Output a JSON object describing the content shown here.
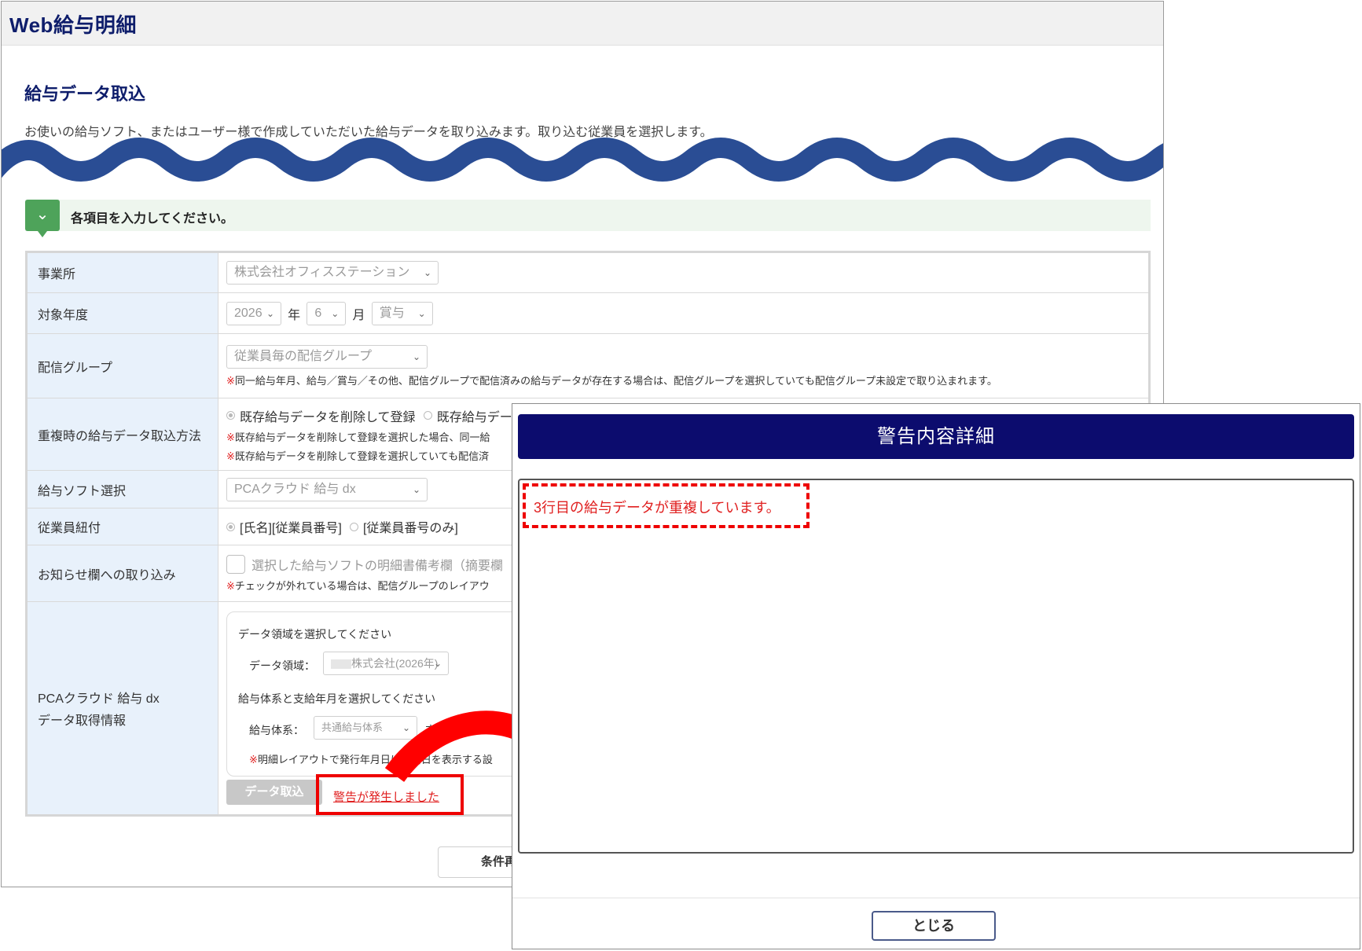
{
  "app": {
    "title": "Web給与明細"
  },
  "page": {
    "title": "給与データ取込",
    "description": "お使いの給与ソフト、またはユーザー様で作成していただいた給与データを取り込みます。取り込む従業員を選択します。"
  },
  "notice": {
    "text": "各項目を入力してください。"
  },
  "form": {
    "office": {
      "label": "事業所",
      "value": "株式会社オフィスステーション"
    },
    "target_year": {
      "label": "対象年度",
      "year": "2026",
      "year_unit": "年",
      "month": "6",
      "month_unit": "月",
      "type": "賞与"
    },
    "group": {
      "label": "配信グループ",
      "value": "従業員毎の配信グループ",
      "note_mark": "※",
      "note": "同一給与年月、給与／賞与／その他、配信グループで配信済みの給与データが存在する場合は、配信グループを選択していても配信グループ未設定で取り込まれます。"
    },
    "duplicate": {
      "label": "重複時の給与データ取込方法",
      "option1": "既存給与データを削除して登録",
      "option2": "既存給与デー",
      "note1_mark": "※",
      "note1": "既存給与データを削除して登録を選択した場合、同一給",
      "note2_mark": "※",
      "note2": "既存給与データを削除して登録を選択していても配信済"
    },
    "software": {
      "label": "給与ソフト選択",
      "value": "PCAクラウド 給与 dx"
    },
    "employee_link": {
      "label": "従業員紐付",
      "option1": "[氏名][従業員番号]",
      "option2": "[従業員番号のみ]"
    },
    "notice_import": {
      "label": "お知らせ欄への取り込み",
      "checkbox_label": "選択した給与ソフトの明細書備考欄（摘要欄",
      "note_mark": "※",
      "note": "チェックが外れている場合は、配信グループのレイアウ"
    },
    "pca": {
      "label_line1": "PCAクラウド 給与 dx",
      "label_line2": "データ取得情報",
      "area_prompt": "データ領域を選択してください",
      "area_label": "データ領域：",
      "area_value": "株式会社(2026年)",
      "system_prompt": "給与体系と支給年月を選択してください",
      "system_label": "給与体系：",
      "system_value": "共通給与体系",
      "pay_month_label": "支給年月",
      "note_mark": "※",
      "note": "明細レイアウトで発行年月日に支給日を表示する設",
      "import_button": "データ取込",
      "warning_link": "警告が発生しました"
    }
  },
  "reset_button": "条件再",
  "modal": {
    "title": "警告内容詳細",
    "message": "3行目の給与データが重複しています。",
    "close_button": "とじる"
  },
  "colors": {
    "brand_navy": "#0e1d6b",
    "modal_header": "#0c0c6e",
    "wave": "#2a4d94",
    "alert_red": "#ee0000",
    "notice_green": "#4ea35a",
    "label_bg": "#e8f1fb"
  }
}
